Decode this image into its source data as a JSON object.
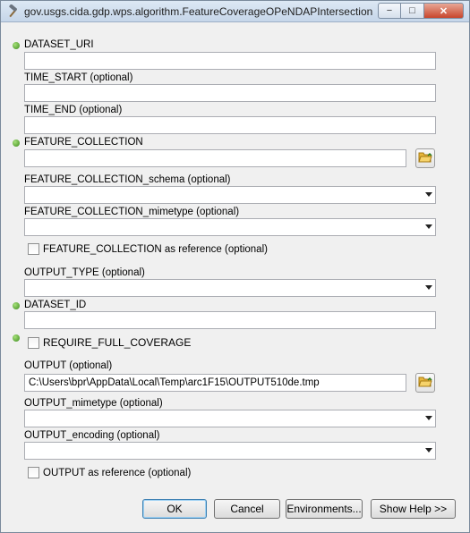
{
  "window": {
    "title": "gov.usgs.cida.gdp.wps.algorithm.FeatureCoverageOPeNDAPIntersection",
    "minimize_label": "−",
    "maximize_label": "□",
    "close_label": "✕"
  },
  "form": {
    "dataset_uri": {
      "label": "DATASET_URI",
      "value": ""
    },
    "time_start": {
      "label": "TIME_START (optional)",
      "value": ""
    },
    "time_end": {
      "label": "TIME_END (optional)",
      "value": ""
    },
    "feature_collection": {
      "label": "FEATURE_COLLECTION",
      "value": ""
    },
    "feature_collection_schema": {
      "label": "FEATURE_COLLECTION_schema (optional)",
      "value": ""
    },
    "feature_collection_mimetype": {
      "label": "FEATURE_COLLECTION_mimetype (optional)",
      "value": ""
    },
    "feature_collection_ref": {
      "label": "FEATURE_COLLECTION as reference (optional)"
    },
    "output_type": {
      "label": "OUTPUT_TYPE (optional)",
      "value": ""
    },
    "dataset_id": {
      "label": "DATASET_ID",
      "value": ""
    },
    "require_full_coverage": {
      "label": "REQUIRE_FULL_COVERAGE"
    },
    "output": {
      "label": "OUTPUT (optional)",
      "value": "C:\\Users\\bpr\\AppData\\Local\\Temp\\arc1F15\\OUTPUT510de.tmp"
    },
    "output_mimetype": {
      "label": "OUTPUT_mimetype (optional)",
      "value": ""
    },
    "output_encoding": {
      "label": "OUTPUT_encoding (optional)",
      "value": ""
    },
    "output_ref": {
      "label": "OUTPUT as reference (optional)"
    }
  },
  "buttons": {
    "ok": "OK",
    "cancel": "Cancel",
    "environments": "Environments...",
    "show_help": "Show Help >>"
  },
  "colors": {
    "required_dot": "#3c8c1c",
    "window_bg": "#f0f0f0"
  },
  "icons": {
    "title": "hammer-icon",
    "required": "required-dot-icon",
    "browse": "folder-icon"
  }
}
